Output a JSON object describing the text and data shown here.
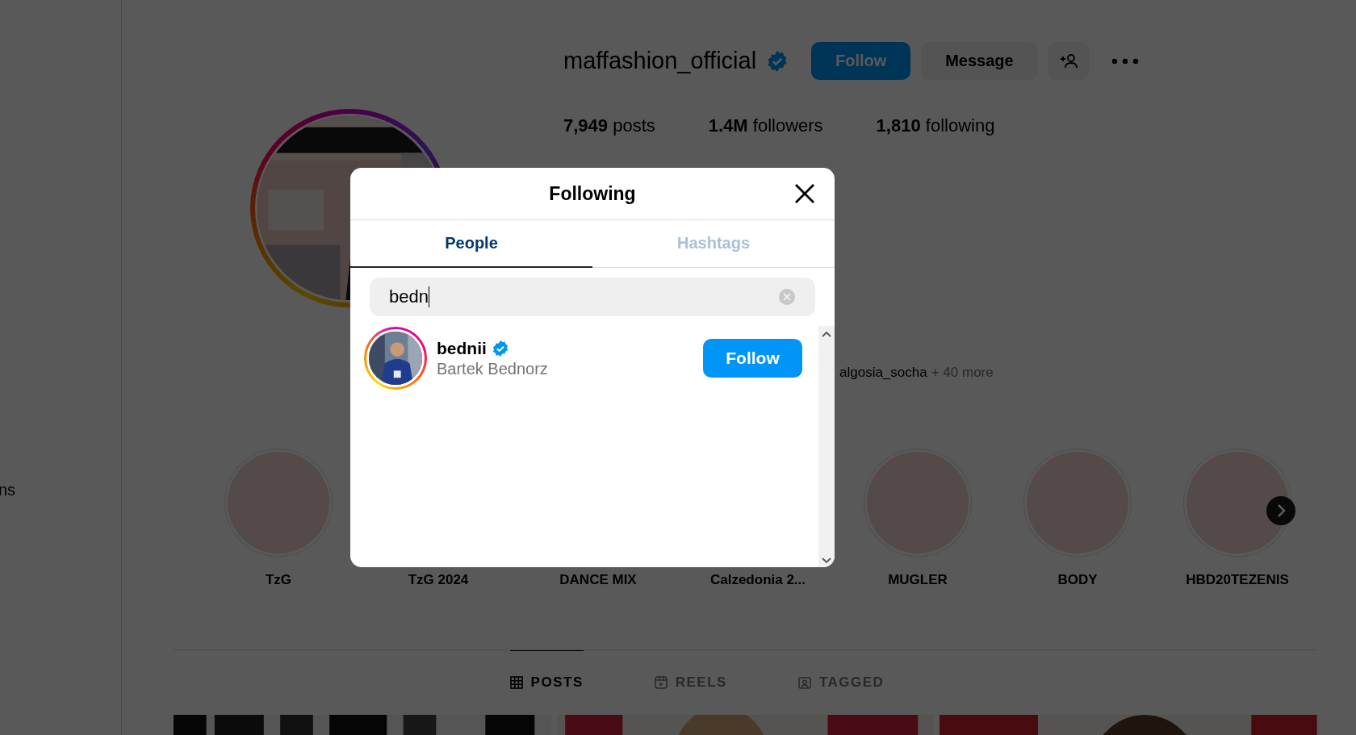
{
  "sidebar": {
    "partial_label": "ns"
  },
  "profile": {
    "username": "maffashion_official",
    "verified": true,
    "follow_button": "Follow",
    "message_button": "Message",
    "stats": [
      {
        "count": "7,949",
        "label": "posts"
      },
      {
        "count": "1.4M",
        "label": "followers"
      },
      {
        "count": "1,810",
        "label": "following"
      }
    ],
    "followed_by": {
      "name": "algosia_socha",
      "more": "+ 40 more"
    }
  },
  "highlights": [
    {
      "title": "TzG"
    },
    {
      "title": "TzG 2024"
    },
    {
      "title": "DANCE MIX"
    },
    {
      "title": "Calzedonia 2..."
    },
    {
      "title": "MUGLER"
    },
    {
      "title": "BODY"
    },
    {
      "title": "HBD20TEZENIS"
    }
  ],
  "content_tabs": [
    {
      "label": "POSTS",
      "kind": "grid",
      "selected": true
    },
    {
      "label": "REELS",
      "kind": "reels",
      "selected": false
    },
    {
      "label": "TAGGED",
      "kind": "tagged",
      "selected": false
    }
  ],
  "modal": {
    "title": "Following",
    "tabs": [
      {
        "label": "People",
        "selected": true
      },
      {
        "label": "Hashtags",
        "selected": false
      }
    ],
    "search": {
      "value": "bedn"
    },
    "results": [
      {
        "username": "bednii",
        "verified": true,
        "full_name": "Bartek Bednorz",
        "button": "Follow"
      }
    ]
  }
}
